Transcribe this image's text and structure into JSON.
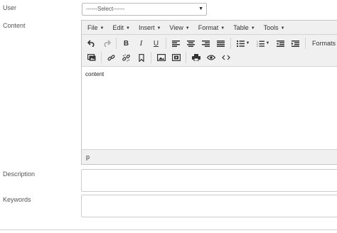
{
  "form": {
    "user_label": "User",
    "user_select_value": "------Select------",
    "content_label": "Content",
    "description_label": "Description",
    "keywords_label": "Keywords"
  },
  "editor": {
    "menu": [
      "File",
      "Edit",
      "Insert",
      "View",
      "Format",
      "Table",
      "Tools"
    ],
    "formats_label": "Formats",
    "body_text": "content",
    "status_path": "p",
    "toolbar_icons": [
      "undo-icon",
      "redo-icon",
      "bold-icon",
      "italic-icon",
      "underline-icon",
      "align-left-icon",
      "align-center-icon",
      "align-right-icon",
      "align-justify-icon",
      "bullet-list-icon",
      "numbered-list-icon",
      "outdent-icon",
      "indent-icon",
      "image-manager-icon",
      "link-icon",
      "unlink-icon",
      "anchor-icon",
      "image-icon",
      "media-icon",
      "print-icon",
      "preview-icon",
      "code-icon"
    ]
  }
}
